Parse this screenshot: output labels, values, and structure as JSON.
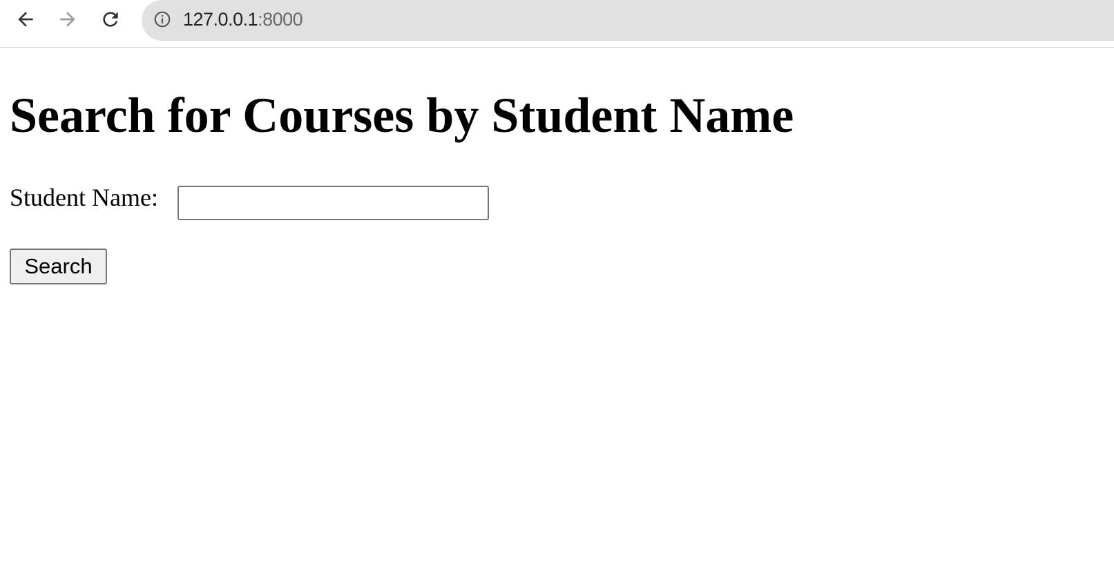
{
  "browser": {
    "url_host": "127.0.0.1",
    "url_port": ":8000"
  },
  "page": {
    "title": "Search for Courses by Student Name",
    "form": {
      "student_name_label": "Student Name:",
      "student_name_value": "",
      "search_button_label": "Search"
    }
  }
}
